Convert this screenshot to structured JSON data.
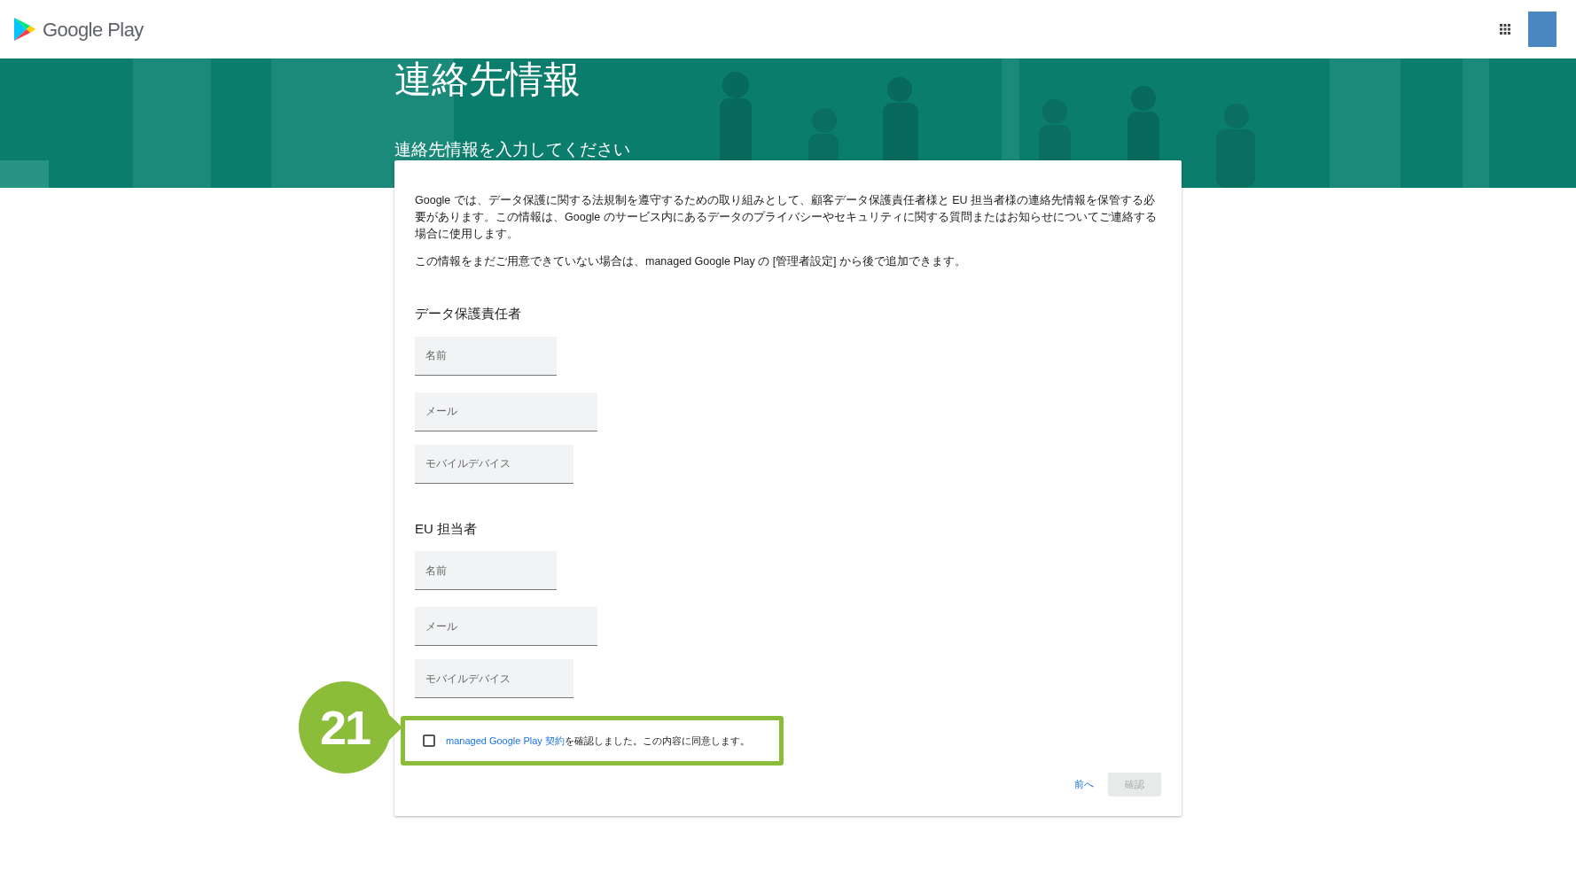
{
  "header": {
    "logo_text": "Google Play"
  },
  "banner": {
    "title": "連絡先情報",
    "subtitle": "連絡先情報を入力してください"
  },
  "intro": [
    "Google では、データ保護に関する法規制を遵守するための取り組みとして、顧客データ保護責任者様と EU 担当者様の連絡先情報を保管する必要があります。この情報は、Google のサービス内にあるデータのプライバシーやセキュリティに関する質問またはお知らせについてご連絡する場合に使用します。",
    "この情報をまだご用意できていない場合は、managed Google Play の [管理者設定] から後で追加できます。"
  ],
  "sections": [
    {
      "heading": "データ保護責任者",
      "fields": [
        {
          "placeholder": "名前"
        },
        {
          "placeholder": "メール"
        },
        {
          "placeholder": "モバイルデバイス"
        }
      ]
    },
    {
      "heading": "EU 担当者",
      "fields": [
        {
          "placeholder": "名前"
        },
        {
          "placeholder": "メール"
        },
        {
          "placeholder": "モバイルデバイス"
        }
      ]
    }
  ],
  "agreement": {
    "link": "managed Google Play 契約",
    "text": "を確認しました。この内容に同意します。",
    "checked": false
  },
  "callout": {
    "number": "21"
  },
  "buttons": {
    "back": "前へ",
    "confirm": "確認",
    "confirm_disabled": true
  }
}
